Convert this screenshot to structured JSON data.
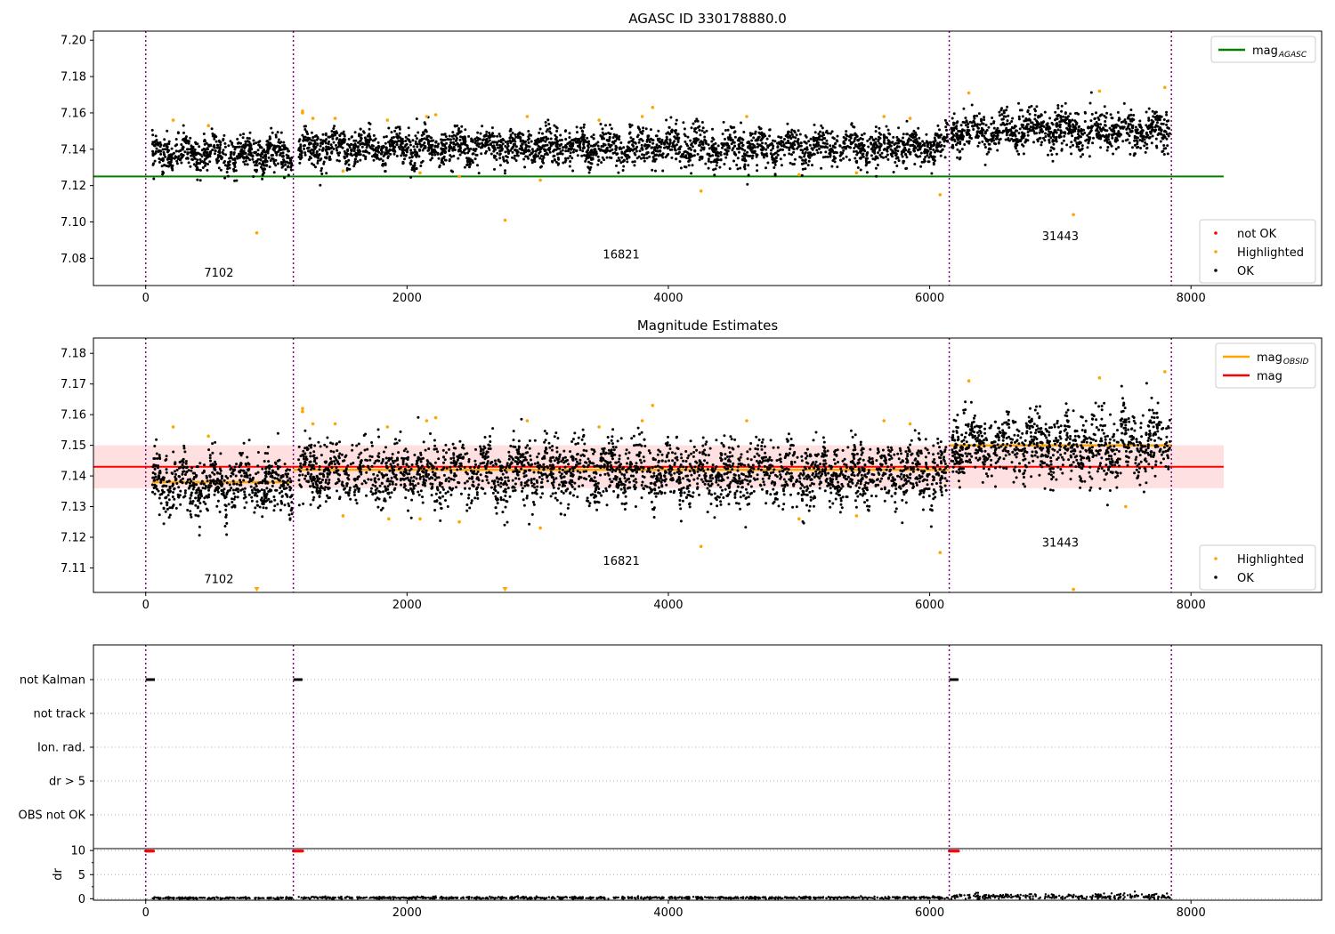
{
  "figure": {
    "title": "AGASC ID 330178880.0",
    "obsid_boundaries": [
      0,
      1130,
      6150,
      7850
    ],
    "obsid_labels": [
      {
        "text": "7102",
        "x": 560
      },
      {
        "text": "16821",
        "x": 3640
      },
      {
        "text": "31443",
        "x": 7000
      }
    ]
  },
  "colors": {
    "ok": "#000000",
    "highlighted": "#ffa500",
    "not_ok": "#ff0000",
    "agasc_line": "#008000",
    "mag_line": "#ff0000",
    "obsid_line": "#ffa500",
    "boundary": "#800080",
    "band": "#ffcccc",
    "grid": "#b0b0b0"
  },
  "chart_data": [
    {
      "id": "panel1",
      "type": "scatter",
      "title": "AGASC ID 330178880.0",
      "xlim": [
        -400,
        9000
      ],
      "ylim": [
        7.065,
        7.205
      ],
      "xticks": [
        0,
        2000,
        4000,
        6000,
        8000
      ],
      "yticks": [
        7.08,
        7.1,
        7.12,
        7.14,
        7.16,
        7.18,
        7.2
      ],
      "ytick_labels": [
        "7.08",
        "7.10",
        "7.12",
        "7.14",
        "7.16",
        "7.18",
        "7.20"
      ],
      "series": [
        {
          "name": "not OK",
          "color": "#ff0000",
          "points": []
        },
        {
          "name": "Highlighted",
          "color": "#ffa500"
        },
        {
          "name": "OK",
          "color": "#000000"
        }
      ],
      "line_mag_agasc": {
        "label": "mag",
        "sub": "AGASC",
        "y": 7.125,
        "x": [
          0,
          8250
        ]
      },
      "obs_segments": [
        {
          "x0": 50,
          "x1": 1120,
          "mean": 7.1375,
          "sd": 0.0055
        },
        {
          "x0": 1170,
          "x1": 6140,
          "mean": 7.141,
          "sd": 0.006
        },
        {
          "x0": 6165,
          "x1": 7840,
          "mean": 7.15,
          "sd": 0.0065
        }
      ],
      "highlighted_points": [
        [
          210,
          7.156
        ],
        [
          480,
          7.153
        ],
        [
          850,
          7.094
        ],
        [
          1200,
          7.161
        ],
        [
          1200,
          7.16
        ],
        [
          1280,
          7.157
        ],
        [
          1450,
          7.157
        ],
        [
          1510,
          7.128
        ],
        [
          1850,
          7.156
        ],
        [
          2100,
          7.127
        ],
        [
          2150,
          7.158
        ],
        [
          2220,
          7.159
        ],
        [
          2400,
          7.125
        ],
        [
          2750,
          7.101
        ],
        [
          3020,
          7.123
        ],
        [
          2920,
          7.158
        ],
        [
          3470,
          7.156
        ],
        [
          3800,
          7.158
        ],
        [
          3880,
          7.163
        ],
        [
          4250,
          7.117
        ],
        [
          4600,
          7.158
        ],
        [
          5000,
          7.126
        ],
        [
          5440,
          7.127
        ],
        [
          5650,
          7.158
        ],
        [
          5850,
          7.157
        ],
        [
          6080,
          7.115
        ],
        [
          6300,
          7.171
        ],
        [
          7100,
          7.104
        ],
        [
          7300,
          7.172
        ],
        [
          7800,
          7.174
        ]
      ],
      "obsid_label_y": [
        7.07,
        7.08,
        7.09
      ],
      "legend_top": [
        {
          "label": "mag",
          "sub": "AGASC",
          "color": "#008000"
        }
      ],
      "legend_bottom": [
        {
          "label": "not OK",
          "color": "#ff0000"
        },
        {
          "label": "Highlighted",
          "color": "#ffa500"
        },
        {
          "label": "OK",
          "color": "#000000"
        }
      ]
    },
    {
      "id": "panel2",
      "type": "scatter",
      "title": "Magnitude Estimates",
      "xlim": [
        -400,
        9000
      ],
      "ylim": [
        7.102,
        7.185
      ],
      "xticks": [
        0,
        2000,
        4000,
        6000,
        8000
      ],
      "yticks": [
        7.11,
        7.12,
        7.13,
        7.14,
        7.15,
        7.16,
        7.17,
        7.18
      ],
      "ytick_labels": [
        "7.11",
        "7.12",
        "7.13",
        "7.14",
        "7.15",
        "7.16",
        "7.17",
        "7.18"
      ],
      "line_mag": {
        "label": "mag",
        "y": 7.143,
        "band": [
          7.136,
          7.15
        ],
        "x": [
          0,
          8250
        ]
      },
      "line_mag_obsid": [
        {
          "x0": 50,
          "x1": 1120,
          "y": 7.138
        },
        {
          "x0": 1130,
          "x1": 6150,
          "y": 7.142
        },
        {
          "x0": 6150,
          "x1": 7850,
          "y": 7.15
        }
      ],
      "obs_segments": [
        {
          "x0": 50,
          "x1": 1120,
          "mean": 7.1375,
          "sd": 0.0055
        },
        {
          "x0": 1170,
          "x1": 6140,
          "mean": 7.141,
          "sd": 0.006
        },
        {
          "x0": 6165,
          "x1": 7840,
          "mean": 7.15,
          "sd": 0.0065
        }
      ],
      "highlighted_points": [
        [
          210,
          7.156
        ],
        [
          480,
          7.153
        ],
        [
          1200,
          7.161
        ],
        [
          1200,
          7.162
        ],
        [
          1280,
          7.157
        ],
        [
          1450,
          7.157
        ],
        [
          1510,
          7.127
        ],
        [
          1850,
          7.156
        ],
        [
          1860,
          7.126
        ],
        [
          2100,
          7.126
        ],
        [
          2150,
          7.158
        ],
        [
          2220,
          7.159
        ],
        [
          2400,
          7.125
        ],
        [
          3020,
          7.123
        ],
        [
          2920,
          7.158
        ],
        [
          3470,
          7.156
        ],
        [
          3800,
          7.158
        ],
        [
          3880,
          7.163
        ],
        [
          4250,
          7.117
        ],
        [
          4600,
          7.158
        ],
        [
          5000,
          7.126
        ],
        [
          5440,
          7.127
        ],
        [
          5650,
          7.158
        ],
        [
          5850,
          7.157
        ],
        [
          6080,
          7.115
        ],
        [
          6300,
          7.171
        ],
        [
          7100,
          7.103
        ],
        [
          7300,
          7.172
        ],
        [
          7800,
          7.174
        ],
        [
          7500,
          7.13
        ]
      ],
      "out_of_range_markers": [
        850,
        2750
      ],
      "obsid_label_y": [
        7.105,
        7.111,
        7.117
      ],
      "legend_top": [
        {
          "label": "mag",
          "sub": "OBSID",
          "color": "#ffa500"
        },
        {
          "label": "mag",
          "color": "#ff0000"
        }
      ],
      "legend_bottom": [
        {
          "label": "Highlighted",
          "color": "#ffa500"
        },
        {
          "label": "OK",
          "color": "#000000"
        }
      ]
    },
    {
      "id": "panel3",
      "type": "scatter",
      "xlim": [
        -400,
        9000
      ],
      "flag_rows": [
        "not Kalman",
        "not track",
        "Ion. rad.",
        "dr > 5",
        "OBS not OK"
      ],
      "flag_not_kalman_x": [
        [
          0,
          70
        ],
        [
          1130,
          1200
        ],
        [
          6150,
          6220
        ]
      ],
      "dr": {
        "ylabel": "dr",
        "ylim": [
          -0.3,
          10.4
        ],
        "yticks": [
          0,
          5,
          10
        ],
        "ytick_labels": [
          "0",
          "5",
          "10"
        ],
        "xticks": [
          0,
          2000,
          4000,
          6000,
          8000
        ],
        "red_clusters": [
          [
            0,
            60
          ],
          [
            1130,
            1200
          ],
          [
            6150,
            6220
          ]
        ]
      }
    }
  ]
}
